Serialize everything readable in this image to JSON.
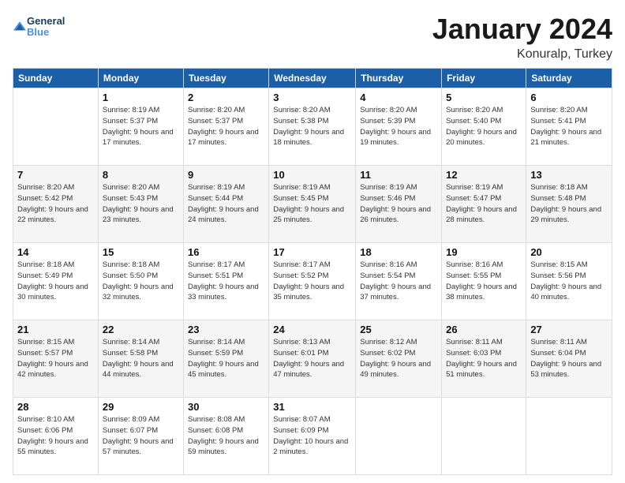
{
  "logo": {
    "text_general": "General",
    "text_blue": "Blue"
  },
  "title": "January 2024",
  "subtitle": "Konuralp, Turkey",
  "headers": [
    "Sunday",
    "Monday",
    "Tuesday",
    "Wednesday",
    "Thursday",
    "Friday",
    "Saturday"
  ],
  "weeks": [
    [
      {
        "day": "",
        "sunrise": "",
        "sunset": "",
        "daylight": ""
      },
      {
        "day": "1",
        "sunrise": "Sunrise: 8:19 AM",
        "sunset": "Sunset: 5:37 PM",
        "daylight": "Daylight: 9 hours and 17 minutes."
      },
      {
        "day": "2",
        "sunrise": "Sunrise: 8:20 AM",
        "sunset": "Sunset: 5:37 PM",
        "daylight": "Daylight: 9 hours and 17 minutes."
      },
      {
        "day": "3",
        "sunrise": "Sunrise: 8:20 AM",
        "sunset": "Sunset: 5:38 PM",
        "daylight": "Daylight: 9 hours and 18 minutes."
      },
      {
        "day": "4",
        "sunrise": "Sunrise: 8:20 AM",
        "sunset": "Sunset: 5:39 PM",
        "daylight": "Daylight: 9 hours and 19 minutes."
      },
      {
        "day": "5",
        "sunrise": "Sunrise: 8:20 AM",
        "sunset": "Sunset: 5:40 PM",
        "daylight": "Daylight: 9 hours and 20 minutes."
      },
      {
        "day": "6",
        "sunrise": "Sunrise: 8:20 AM",
        "sunset": "Sunset: 5:41 PM",
        "daylight": "Daylight: 9 hours and 21 minutes."
      }
    ],
    [
      {
        "day": "7",
        "sunrise": "Sunrise: 8:20 AM",
        "sunset": "Sunset: 5:42 PM",
        "daylight": "Daylight: 9 hours and 22 minutes."
      },
      {
        "day": "8",
        "sunrise": "Sunrise: 8:20 AM",
        "sunset": "Sunset: 5:43 PM",
        "daylight": "Daylight: 9 hours and 23 minutes."
      },
      {
        "day": "9",
        "sunrise": "Sunrise: 8:19 AM",
        "sunset": "Sunset: 5:44 PM",
        "daylight": "Daylight: 9 hours and 24 minutes."
      },
      {
        "day": "10",
        "sunrise": "Sunrise: 8:19 AM",
        "sunset": "Sunset: 5:45 PM",
        "daylight": "Daylight: 9 hours and 25 minutes."
      },
      {
        "day": "11",
        "sunrise": "Sunrise: 8:19 AM",
        "sunset": "Sunset: 5:46 PM",
        "daylight": "Daylight: 9 hours and 26 minutes."
      },
      {
        "day": "12",
        "sunrise": "Sunrise: 8:19 AM",
        "sunset": "Sunset: 5:47 PM",
        "daylight": "Daylight: 9 hours and 28 minutes."
      },
      {
        "day": "13",
        "sunrise": "Sunrise: 8:18 AM",
        "sunset": "Sunset: 5:48 PM",
        "daylight": "Daylight: 9 hours and 29 minutes."
      }
    ],
    [
      {
        "day": "14",
        "sunrise": "Sunrise: 8:18 AM",
        "sunset": "Sunset: 5:49 PM",
        "daylight": "Daylight: 9 hours and 30 minutes."
      },
      {
        "day": "15",
        "sunrise": "Sunrise: 8:18 AM",
        "sunset": "Sunset: 5:50 PM",
        "daylight": "Daylight: 9 hours and 32 minutes."
      },
      {
        "day": "16",
        "sunrise": "Sunrise: 8:17 AM",
        "sunset": "Sunset: 5:51 PM",
        "daylight": "Daylight: 9 hours and 33 minutes."
      },
      {
        "day": "17",
        "sunrise": "Sunrise: 8:17 AM",
        "sunset": "Sunset: 5:52 PM",
        "daylight": "Daylight: 9 hours and 35 minutes."
      },
      {
        "day": "18",
        "sunrise": "Sunrise: 8:16 AM",
        "sunset": "Sunset: 5:54 PM",
        "daylight": "Daylight: 9 hours and 37 minutes."
      },
      {
        "day": "19",
        "sunrise": "Sunrise: 8:16 AM",
        "sunset": "Sunset: 5:55 PM",
        "daylight": "Daylight: 9 hours and 38 minutes."
      },
      {
        "day": "20",
        "sunrise": "Sunrise: 8:15 AM",
        "sunset": "Sunset: 5:56 PM",
        "daylight": "Daylight: 9 hours and 40 minutes."
      }
    ],
    [
      {
        "day": "21",
        "sunrise": "Sunrise: 8:15 AM",
        "sunset": "Sunset: 5:57 PM",
        "daylight": "Daylight: 9 hours and 42 minutes."
      },
      {
        "day": "22",
        "sunrise": "Sunrise: 8:14 AM",
        "sunset": "Sunset: 5:58 PM",
        "daylight": "Daylight: 9 hours and 44 minutes."
      },
      {
        "day": "23",
        "sunrise": "Sunrise: 8:14 AM",
        "sunset": "Sunset: 5:59 PM",
        "daylight": "Daylight: 9 hours and 45 minutes."
      },
      {
        "day": "24",
        "sunrise": "Sunrise: 8:13 AM",
        "sunset": "Sunset: 6:01 PM",
        "daylight": "Daylight: 9 hours and 47 minutes."
      },
      {
        "day": "25",
        "sunrise": "Sunrise: 8:12 AM",
        "sunset": "Sunset: 6:02 PM",
        "daylight": "Daylight: 9 hours and 49 minutes."
      },
      {
        "day": "26",
        "sunrise": "Sunrise: 8:11 AM",
        "sunset": "Sunset: 6:03 PM",
        "daylight": "Daylight: 9 hours and 51 minutes."
      },
      {
        "day": "27",
        "sunrise": "Sunrise: 8:11 AM",
        "sunset": "Sunset: 6:04 PM",
        "daylight": "Daylight: 9 hours and 53 minutes."
      }
    ],
    [
      {
        "day": "28",
        "sunrise": "Sunrise: 8:10 AM",
        "sunset": "Sunset: 6:06 PM",
        "daylight": "Daylight: 9 hours and 55 minutes."
      },
      {
        "day": "29",
        "sunrise": "Sunrise: 8:09 AM",
        "sunset": "Sunset: 6:07 PM",
        "daylight": "Daylight: 9 hours and 57 minutes."
      },
      {
        "day": "30",
        "sunrise": "Sunrise: 8:08 AM",
        "sunset": "Sunset: 6:08 PM",
        "daylight": "Daylight: 9 hours and 59 minutes."
      },
      {
        "day": "31",
        "sunrise": "Sunrise: 8:07 AM",
        "sunset": "Sunset: 6:09 PM",
        "daylight": "Daylight: 10 hours and 2 minutes."
      },
      {
        "day": "",
        "sunrise": "",
        "sunset": "",
        "daylight": ""
      },
      {
        "day": "",
        "sunrise": "",
        "sunset": "",
        "daylight": ""
      },
      {
        "day": "",
        "sunrise": "",
        "sunset": "",
        "daylight": ""
      }
    ]
  ]
}
